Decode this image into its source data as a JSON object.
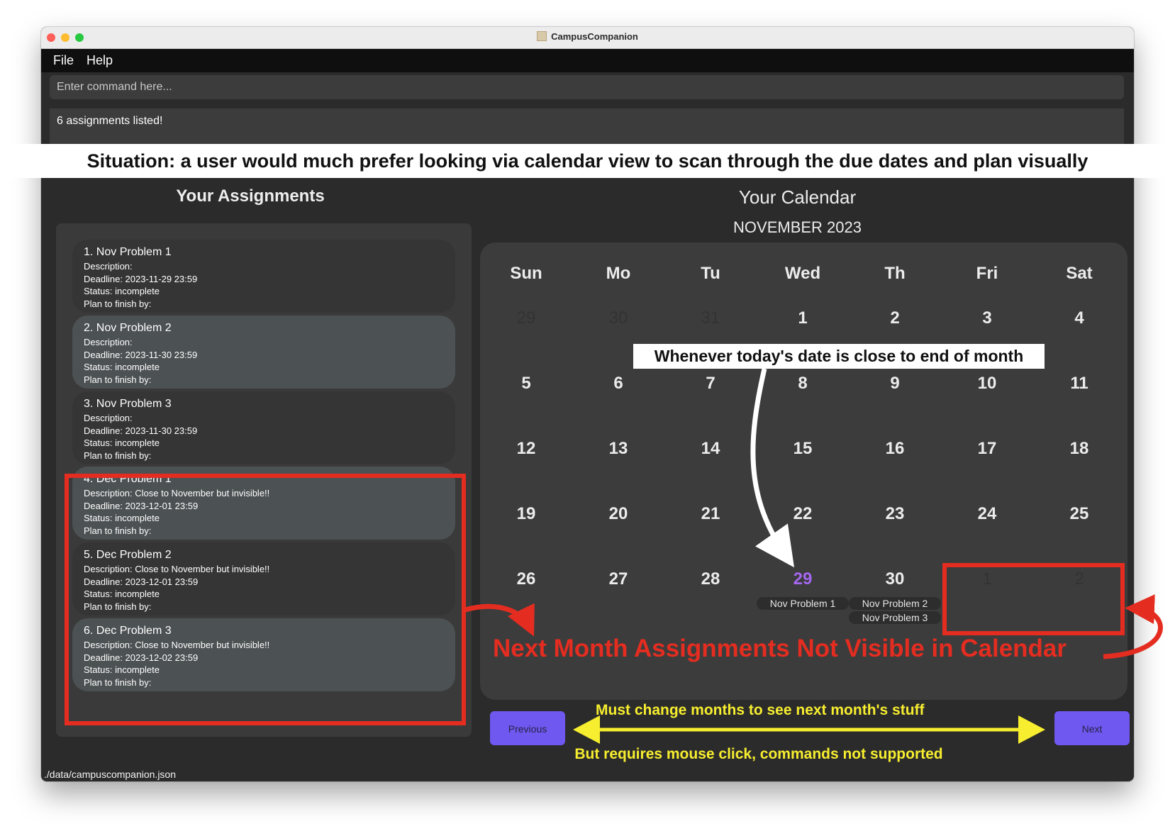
{
  "window": {
    "title": "CampusCompanion"
  },
  "menu": {
    "file": "File",
    "help": "Help"
  },
  "command": {
    "placeholder": "Enter command here..."
  },
  "result": {
    "message": "6 assignments listed!"
  },
  "banner": "Situation: a user would much prefer looking via calendar view to scan through the due dates and plan visually",
  "assignments": {
    "heading": "Your Assignments",
    "items": [
      {
        "title": "1.  Nov Problem 1",
        "description": "Description:",
        "deadline": "Deadline: 2023-11-29 23:59",
        "status": "Status: incomplete",
        "plan": "Plan to finish by:"
      },
      {
        "title": "2.  Nov Problem 2",
        "description": "Description:",
        "deadline": "Deadline: 2023-11-30 23:59",
        "status": "Status: incomplete",
        "plan": "Plan to finish by:"
      },
      {
        "title": "3.  Nov Problem 3",
        "description": "Description:",
        "deadline": "Deadline: 2023-11-30 23:59",
        "status": "Status: incomplete",
        "plan": "Plan to finish by:"
      },
      {
        "title": "4.  Dec Problem 1",
        "description": "Description: Close to November but invisible!!",
        "deadline": "Deadline: 2023-12-01 23:59",
        "status": "Status: incomplete",
        "plan": "Plan to finish by:"
      },
      {
        "title": "5.  Dec Problem 2",
        "description": "Description: Close to November but invisible!!",
        "deadline": "Deadline: 2023-12-01 23:59",
        "status": "Status: incomplete",
        "plan": "Plan to finish by:"
      },
      {
        "title": "6.  Dec Problem 3",
        "description": "Description: Close to November but invisible!!",
        "deadline": "Deadline: 2023-12-02 23:59",
        "status": "Status: incomplete",
        "plan": "Plan to finish by:"
      }
    ]
  },
  "calendar": {
    "heading": "Your Calendar",
    "month": "NOVEMBER 2023",
    "weekdays": [
      "Sun",
      "Mo",
      "Tu",
      "Wed",
      "Th",
      "Fri",
      "Sat"
    ],
    "weeks": [
      [
        "29",
        "30",
        "31",
        "1",
        "2",
        "3",
        "4"
      ],
      [
        "5",
        "6",
        "7",
        "8",
        "9",
        "10",
        "11"
      ],
      [
        "12",
        "13",
        "14",
        "15",
        "16",
        "17",
        "18"
      ],
      [
        "19",
        "20",
        "21",
        "22",
        "23",
        "24",
        "25"
      ],
      [
        "26",
        "27",
        "28",
        "29",
        "30",
        "1",
        "2"
      ]
    ],
    "today": "29",
    "events": {
      "nov29": [
        "Nov Problem 1"
      ],
      "nov30": [
        "Nov Problem 2",
        "Nov Problem 3"
      ]
    },
    "today_color": "#a467ee"
  },
  "buttons": {
    "previous": "Previous",
    "next": "Next"
  },
  "footer": {
    "path": "./data/campuscompanion.json"
  },
  "annotations": {
    "white": "Whenever today's date is close to end of month",
    "red": "Next Month Assignments Not Visible in Calendar",
    "yellow_top": "Must change months to see next month's stuff",
    "yellow_bottom": "But requires mouse click, commands not supported"
  },
  "colors": {
    "accent": "#6e58f0",
    "annotation_red": "#e42d20",
    "annotation_yellow": "#f7ee2f"
  }
}
